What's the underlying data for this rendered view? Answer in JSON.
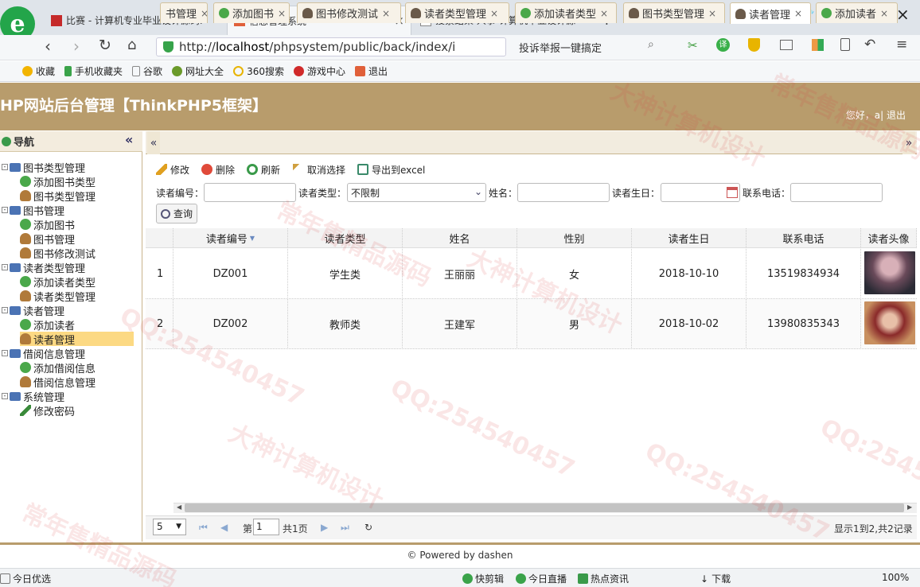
{
  "browser": {
    "tabs": [
      {
        "title": "比赛 - 计算机专业毕业设计源码P"
      },
      {
        "title": "信息管理系统"
      },
      {
        "title": "搜索结果 人事-计算机毕业设计源"
      }
    ],
    "tab_count": "3",
    "url_prefix": "http://",
    "url_host": "localhost",
    "url_path": "/phpsystem/public/back/index/i",
    "report_text": "投诉举报一键搞定",
    "bookmarks": [
      "收藏",
      "手机收藏夹",
      "谷歌",
      "网址大全",
      "360搜索",
      "游戏中心",
      "退出"
    ]
  },
  "app": {
    "title": "HP网站后台管理【ThinkPHP5框架】",
    "user_info": "您好，a| 退出"
  },
  "nav": {
    "heading": "导航",
    "collapse_glyph": "«",
    "groups": [
      {
        "label": "图书类型管理",
        "items": [
          "添加图书类型",
          "图书类型管理"
        ]
      },
      {
        "label": "图书管理",
        "items": [
          "添加图书",
          "图书管理",
          "图书修改测试"
        ]
      },
      {
        "label": "读者类型管理",
        "items": [
          "添加读者类型",
          "读者类型管理"
        ]
      },
      {
        "label": "读者管理",
        "items": [
          "添加读者",
          "读者管理"
        ]
      },
      {
        "label": "借阅信息管理",
        "items": [
          "添加借阅信息",
          "借阅信息管理"
        ]
      },
      {
        "label": "系统管理",
        "items": [
          "修改密码"
        ]
      }
    ],
    "selected": "读者管理"
  },
  "panel_tabs": [
    {
      "label": "书管理"
    },
    {
      "label": "添加图书"
    },
    {
      "label": "图书修改测试"
    },
    {
      "label": "读者类型管理"
    },
    {
      "label": "添加读者类型"
    },
    {
      "label": "图书类型管理"
    },
    {
      "label": "读者管理"
    },
    {
      "label": "添加读者"
    }
  ],
  "toolbar": {
    "edit": "修改",
    "delete": "删除",
    "refresh": "刷新",
    "unselect": "取消选择",
    "export": "导出到excel"
  },
  "filters": {
    "reader_no_label": "读者编号：",
    "reader_type_label": "读者类型：",
    "reader_type_value": "不限制",
    "name_label": "姓名：",
    "birthday_label": "读者生日：",
    "phone_label": "联系电话：",
    "search": "查询"
  },
  "grid": {
    "columns": [
      "读者编号",
      "读者类型",
      "姓名",
      "性别",
      "读者生日",
      "联系电话",
      "读者头像"
    ],
    "rows": [
      {
        "num": "1",
        "cells": [
          "DZ001",
          "学生类",
          "王丽丽",
          "女",
          "2018-10-10",
          "13519834934"
        ]
      },
      {
        "num": "2",
        "cells": [
          "DZ002",
          "教师类",
          "王建军",
          "男",
          "2018-10-02",
          "13980835343"
        ]
      }
    ]
  },
  "pager": {
    "page_size": "5",
    "page_prefix": "第",
    "page_value": "1",
    "page_total": "共1页",
    "summary": "显示1到2,共2记录"
  },
  "footer": {
    "powered": "© Powered by dashen"
  },
  "statusbar": {
    "left": "今日优选",
    "items": [
      "快剪辑",
      "今日直播",
      "热点资讯",
      "下载"
    ],
    "zoom": "100%"
  },
  "watermark": [
    "QQ:254540457",
    "大神计算机设计",
    "常年售精品源码"
  ]
}
